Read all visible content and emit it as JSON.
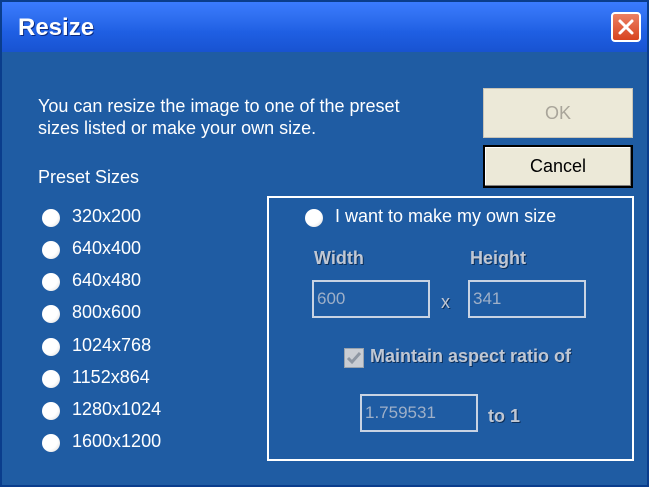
{
  "window": {
    "title": "Resize"
  },
  "intro": {
    "line1": "You can resize the image to one of the preset",
    "line2": "sizes listed or make your own size."
  },
  "buttons": {
    "ok": "OK",
    "cancel": "Cancel"
  },
  "presets": {
    "heading": "Preset Sizes",
    "items": [
      "320x200",
      "640x400",
      "640x480",
      "800x600",
      "1024x768",
      "1152x864",
      "1280x1024",
      "1600x1200"
    ]
  },
  "custom": {
    "radio_label": "I want to make my own size",
    "width_label": "Width",
    "height_label": "Height",
    "width_value": "600",
    "height_value": "341",
    "times": "x",
    "aspect_label": "Maintain aspect ratio of",
    "aspect_checked": true,
    "ratio_value": "1.759531",
    "to_one": "to 1"
  },
  "icons": {
    "close": "close-icon",
    "check": "checkmark-icon"
  },
  "colors": {
    "dialog_bg": "#1f5ca3",
    "title_bar": "#2f6ff0",
    "close_button": "#d7431f"
  }
}
